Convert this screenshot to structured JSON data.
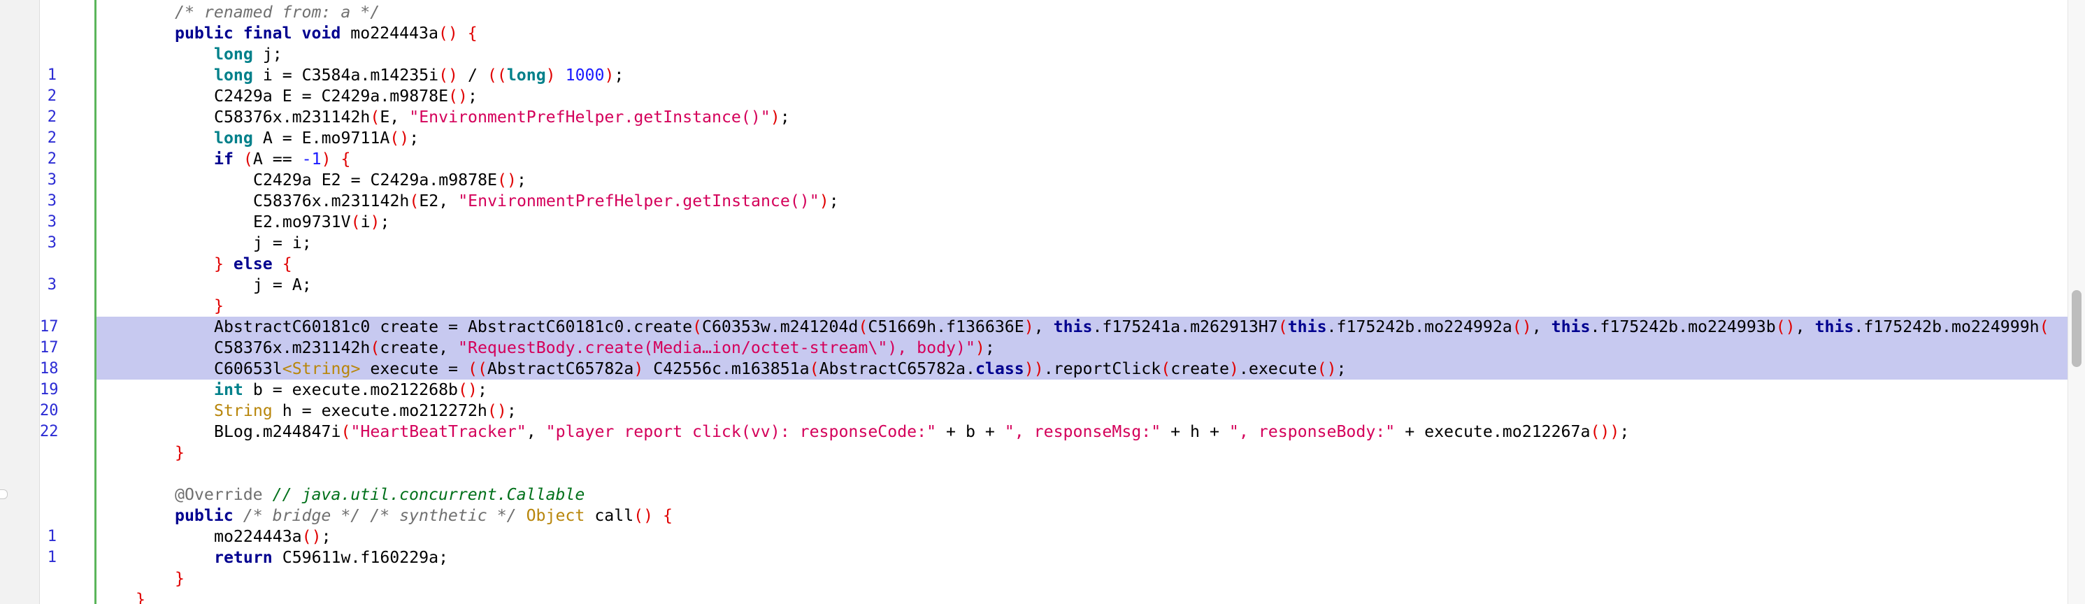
{
  "editor": {
    "lines": [
      {
        "ln": "",
        "indent": 1,
        "tokens": [
          [
            "cm",
            "/* renamed from: a */"
          ]
        ]
      },
      {
        "ln": "",
        "indent": 1,
        "tokens": [
          [
            "kw",
            "public final void "
          ],
          [
            "t",
            "mo224443a"
          ],
          [
            "pn",
            "() {"
          ]
        ]
      },
      {
        "ln": "",
        "indent": 2,
        "tokens": [
          [
            "ty",
            "long "
          ],
          [
            "t",
            "j;"
          ]
        ]
      },
      {
        "ln": "1",
        "indent": 2,
        "tokens": [
          [
            "ty",
            "long "
          ],
          [
            "t",
            "i = C3584a.m14235i"
          ],
          [
            "pn",
            "()"
          ],
          [
            "t",
            " / "
          ],
          [
            "pn",
            "(("
          ],
          [
            "ty",
            "long"
          ],
          [
            "pn",
            ")"
          ],
          [
            "t",
            " "
          ],
          [
            "num",
            "1000"
          ],
          [
            "pn",
            ")"
          ],
          [
            "t",
            ";"
          ]
        ]
      },
      {
        "ln": "2",
        "indent": 2,
        "tokens": [
          [
            "t",
            "C2429a E = C2429a.m9878E"
          ],
          [
            "pn",
            "()"
          ],
          [
            "t",
            ";"
          ]
        ]
      },
      {
        "ln": "2",
        "indent": 2,
        "tokens": [
          [
            "t",
            "C58376x.m231142h"
          ],
          [
            "pn",
            "("
          ],
          [
            "t",
            "E, "
          ],
          [
            "str",
            "\"EnvironmentPrefHelper.getInstance()\""
          ],
          [
            "pn",
            ")"
          ],
          [
            "t",
            ";"
          ]
        ]
      },
      {
        "ln": "2",
        "indent": 2,
        "tokens": [
          [
            "ty",
            "long "
          ],
          [
            "t",
            "A = E.mo9711A"
          ],
          [
            "pn",
            "()"
          ],
          [
            "t",
            ";"
          ]
        ]
      },
      {
        "ln": "2",
        "indent": 2,
        "tokens": [
          [
            "kw",
            "if "
          ],
          [
            "pn",
            "("
          ],
          [
            "t",
            "A == "
          ],
          [
            "num",
            "-1"
          ],
          [
            "pn",
            ") {"
          ]
        ]
      },
      {
        "ln": "3",
        "indent": 3,
        "tokens": [
          [
            "t",
            "C2429a E2 = C2429a.m9878E"
          ],
          [
            "pn",
            "()"
          ],
          [
            "t",
            ";"
          ]
        ]
      },
      {
        "ln": "3",
        "indent": 3,
        "tokens": [
          [
            "t",
            "C58376x.m231142h"
          ],
          [
            "pn",
            "("
          ],
          [
            "t",
            "E2, "
          ],
          [
            "str",
            "\"EnvironmentPrefHelper.getInstance()\""
          ],
          [
            "pn",
            ")"
          ],
          [
            "t",
            ";"
          ]
        ]
      },
      {
        "ln": "3",
        "indent": 3,
        "tokens": [
          [
            "t",
            "E2.mo9731V"
          ],
          [
            "pn",
            "("
          ],
          [
            "t",
            "i"
          ],
          [
            "pn",
            ")"
          ],
          [
            "t",
            ";"
          ]
        ]
      },
      {
        "ln": "3",
        "indent": 3,
        "tokens": [
          [
            "t",
            "j = i;"
          ]
        ]
      },
      {
        "ln": "",
        "indent": 2,
        "tokens": [
          [
            "pn",
            "} "
          ],
          [
            "kw",
            "else "
          ],
          [
            "pn",
            "{"
          ]
        ]
      },
      {
        "ln": "3",
        "indent": 3,
        "tokens": [
          [
            "t",
            "j = A;"
          ]
        ]
      },
      {
        "ln": "",
        "indent": 2,
        "tokens": [
          [
            "pn",
            "}"
          ]
        ]
      },
      {
        "ln": "17",
        "indent": 2,
        "sel": true,
        "tokens": [
          [
            "t",
            "AbstractC60181c0 create = AbstractC60181c0.create"
          ],
          [
            "pn",
            "("
          ],
          [
            "t",
            "C60353w.m241204d"
          ],
          [
            "pn",
            "("
          ],
          [
            "t",
            "C51669h.f136636E"
          ],
          [
            "pn",
            ")"
          ],
          [
            "t",
            ", "
          ],
          [
            "kw",
            "this"
          ],
          [
            "t",
            ".f175241a.m262913H7"
          ],
          [
            "pn",
            "("
          ],
          [
            "kw",
            "this"
          ],
          [
            "t",
            ".f175242b.mo224992a"
          ],
          [
            "pn",
            "()"
          ],
          [
            "t",
            ", "
          ],
          [
            "kw",
            "this"
          ],
          [
            "t",
            ".f175242b.mo224993b"
          ],
          [
            "pn",
            "()"
          ],
          [
            "t",
            ", "
          ],
          [
            "kw",
            "this"
          ],
          [
            "t",
            ".f175242b.mo224999h"
          ],
          [
            "pn",
            "("
          ]
        ]
      },
      {
        "ln": "17",
        "indent": 2,
        "sel": true,
        "tokens": [
          [
            "t",
            "C58376x.m231142h"
          ],
          [
            "pn",
            "("
          ],
          [
            "t",
            "create, "
          ],
          [
            "str",
            "\"RequestBody.create(Media…ion/octet-stream\\\"), body)\""
          ],
          [
            "pn",
            ")"
          ],
          [
            "t",
            ";"
          ]
        ]
      },
      {
        "ln": "18",
        "indent": 2,
        "sel": true,
        "tokens": [
          [
            "t",
            "C60653l"
          ],
          [
            "ob",
            "<String>"
          ],
          [
            "t",
            " execute = "
          ],
          [
            "pn",
            "(("
          ],
          [
            "t",
            "AbstractC65782a"
          ],
          [
            "pn",
            ")"
          ],
          [
            "t",
            " C42556c.m163851a"
          ],
          [
            "pn",
            "("
          ],
          [
            "t",
            "AbstractC65782a."
          ],
          [
            "kw",
            "class"
          ],
          [
            "pn",
            "))"
          ],
          [
            "t",
            ".reportClick"
          ],
          [
            "pn",
            "("
          ],
          [
            "t",
            "create"
          ],
          [
            "pn",
            ")"
          ],
          [
            "t",
            ".execute"
          ],
          [
            "pn",
            "()"
          ],
          [
            "t",
            ";"
          ]
        ]
      },
      {
        "ln": "19",
        "indent": 2,
        "tokens": [
          [
            "ty",
            "int "
          ],
          [
            "t",
            "b = execute.mo212268b"
          ],
          [
            "pn",
            "()"
          ],
          [
            "t",
            ";"
          ]
        ]
      },
      {
        "ln": "20",
        "indent": 2,
        "tokens": [
          [
            "ob",
            "String "
          ],
          [
            "t",
            "h = execute.mo212272h"
          ],
          [
            "pn",
            "()"
          ],
          [
            "t",
            ";"
          ]
        ]
      },
      {
        "ln": "22",
        "indent": 2,
        "tokens": [
          [
            "t",
            "BLog.m244847i"
          ],
          [
            "pn",
            "("
          ],
          [
            "str",
            "\"HeartBeatTracker\""
          ],
          [
            "t",
            ", "
          ],
          [
            "str",
            "\"player report click(vv): responseCode:\""
          ],
          [
            "t",
            " + b + "
          ],
          [
            "str",
            "\", responseMsg:\""
          ],
          [
            "t",
            " + h + "
          ],
          [
            "str",
            "\", responseBody:\""
          ],
          [
            "t",
            " + execute.mo212267a"
          ],
          [
            "pn",
            "())"
          ],
          [
            "t",
            ";"
          ]
        ]
      },
      {
        "ln": "",
        "indent": 1,
        "tokens": [
          [
            "pn",
            "}"
          ]
        ]
      },
      {
        "ln": "",
        "indent": 0,
        "tokens": []
      },
      {
        "ln": "",
        "indent": 1,
        "tokens": [
          [
            "an",
            "@Override "
          ],
          [
            "cm2",
            "// java.util.concurrent.Callable"
          ]
        ]
      },
      {
        "ln": "",
        "indent": 1,
        "tokens": [
          [
            "kw",
            "public "
          ],
          [
            "cm",
            "/* bridge */ /* synthetic */ "
          ],
          [
            "ob",
            "Object "
          ],
          [
            "t",
            "call"
          ],
          [
            "pn",
            "() {"
          ]
        ]
      },
      {
        "ln": "1",
        "indent": 2,
        "tokens": [
          [
            "t",
            "mo224443a"
          ],
          [
            "pn",
            "()"
          ],
          [
            "t",
            ";"
          ]
        ]
      },
      {
        "ln": "1",
        "indent": 2,
        "tokens": [
          [
            "kw",
            "return "
          ],
          [
            "t",
            "C59611w.f160229a;"
          ]
        ]
      },
      {
        "ln": "",
        "indent": 1,
        "tokens": [
          [
            "pn",
            "}"
          ]
        ]
      },
      {
        "ln": "",
        "indent": 0,
        "tokens": [
          [
            "pn",
            "}"
          ]
        ]
      }
    ]
  }
}
